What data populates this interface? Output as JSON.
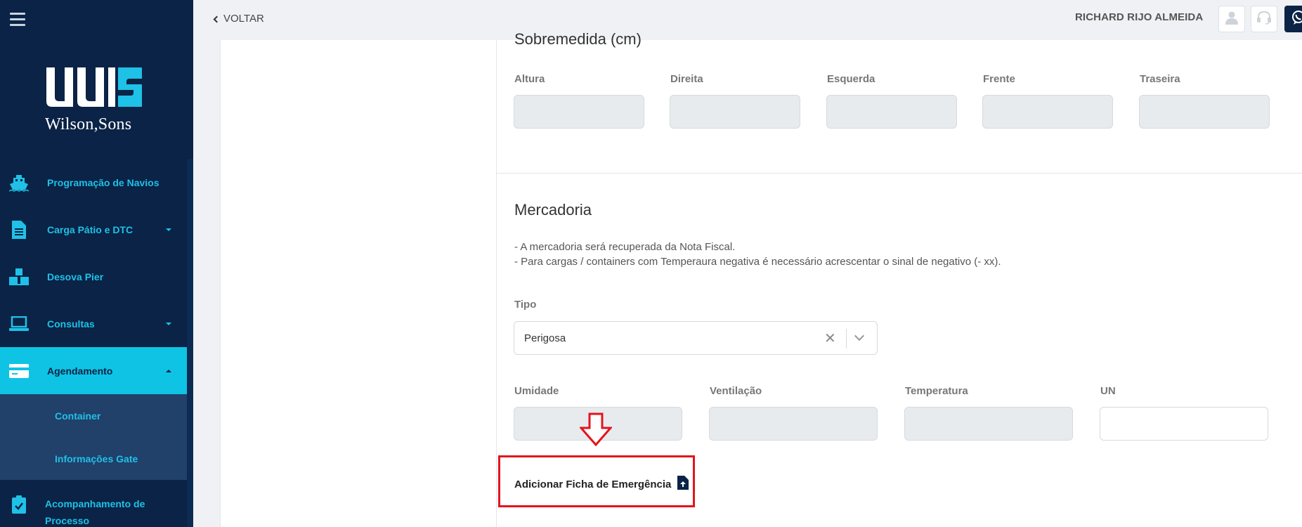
{
  "brand": {
    "name": "Wilson,Sons"
  },
  "sidebar": {
    "items": [
      {
        "label": "Programação de Navios",
        "icon": "ship-icon",
        "has_caret": false
      },
      {
        "label": "Carga Pátio e DTC",
        "icon": "document-icon",
        "has_caret": true
      },
      {
        "label": "Desova Pier",
        "icon": "boxes-icon",
        "has_caret": false
      },
      {
        "label": "Consultas",
        "icon": "laptop-icon",
        "has_caret": true
      },
      {
        "label": "Agendamento",
        "icon": "card-icon",
        "has_caret": true,
        "active": true
      }
    ],
    "submenu": [
      {
        "label": "Container"
      },
      {
        "label": "Informações Gate"
      }
    ],
    "last_item": {
      "label": "Acompanhamento de Processo",
      "icon": "clipboard-check-icon"
    }
  },
  "topbar": {
    "back_label": "VOLTAR",
    "user_name": "RICHARD RIJO ALMEIDA"
  },
  "oversize": {
    "title": "Sobremedida (cm)",
    "fields": [
      {
        "label": "Altura",
        "value": ""
      },
      {
        "label": "Direita",
        "value": ""
      },
      {
        "label": "Esquerda",
        "value": ""
      },
      {
        "label": "Frente",
        "value": ""
      },
      {
        "label": "Traseira",
        "value": ""
      }
    ]
  },
  "cargo": {
    "title": "Mercadoria",
    "notes": [
      "- A mercadoria será recuperada da Nota Fiscal.",
      "- Para cargas / containers com Temperaura negativa é necessário acrescentar o sinal de negativo (- xx)."
    ],
    "type_label": "Tipo",
    "type_value": "Perigosa",
    "fields": [
      {
        "label": "Umidade",
        "value": ""
      },
      {
        "label": "Ventilação",
        "value": ""
      },
      {
        "label": "Temperatura",
        "value": ""
      },
      {
        "label": "UN",
        "value": ""
      }
    ],
    "emergency_link": "Adicionar Ficha de Emergência"
  },
  "colors": {
    "sidebar_bg": "#0a2346",
    "accent": "#0fc3e5",
    "highlight": "#e3141d"
  }
}
